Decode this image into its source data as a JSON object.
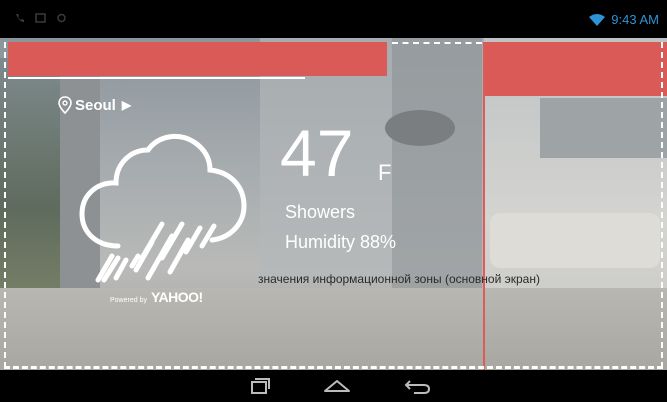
{
  "status_bar": {
    "time": "9:43 AM",
    "icons": [
      "call-icon",
      "notification-icon",
      "settings-icon",
      "wifi-icon"
    ]
  },
  "weather": {
    "location": "Seoul",
    "location_arrow": "▶",
    "temperature": "47",
    "unit": "F",
    "condition": "Showers",
    "humidity": "Humidity 88%",
    "powered_by_small": "Powered by",
    "powered_by_brand": "YAHOO!",
    "icon": "cloud-rain-icon"
  },
  "annotation": {
    "text": "значения информационной зоны (основной экран)"
  },
  "colors": {
    "annotation_red": "#d95a57",
    "clock_blue": "#2f93d6"
  },
  "nav_bar": {
    "buttons": [
      "recent-apps-icon",
      "home-icon",
      "back-icon"
    ]
  }
}
